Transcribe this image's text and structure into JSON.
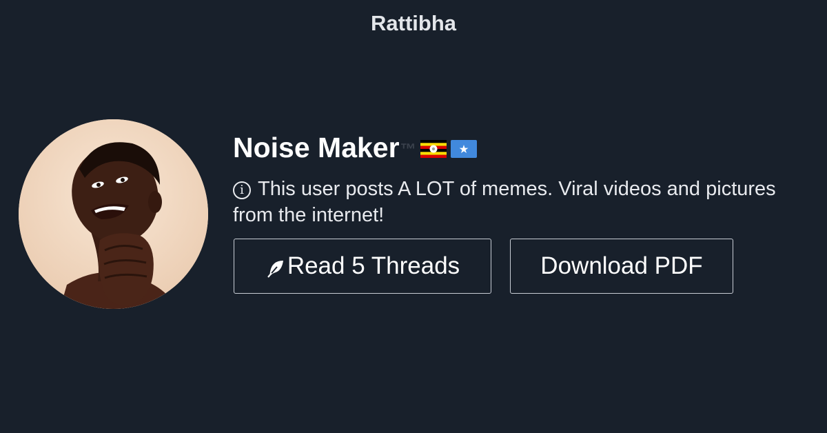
{
  "site": {
    "brand": "Rattibha"
  },
  "profile": {
    "name": "Noise Maker",
    "tm": "™",
    "flags": [
      "uganda-flag",
      "somalia-flag"
    ],
    "bio_icon": "info-icon",
    "bio": "This user posts A LOT of memes. Viral videos and pictures from the internet!"
  },
  "actions": {
    "read_label": "Read 5 Threads",
    "read_icon": "feather-icon",
    "download_label": "Download PDF"
  },
  "colors": {
    "background": "#18202b",
    "text": "#ffffff",
    "button_border": "#c9ced6",
    "tm": "#3a414c"
  }
}
